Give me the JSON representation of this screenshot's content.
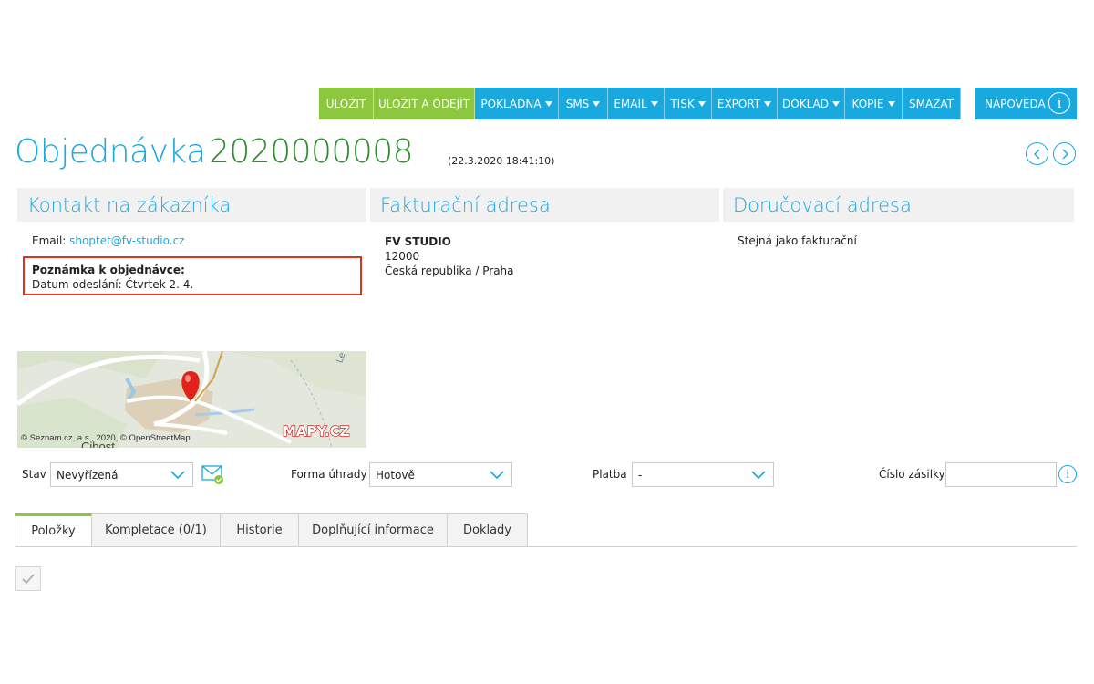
{
  "toolbar": {
    "save": "ULOŽIT",
    "save_exit": "ULOŽIT A ODEJÍT",
    "pokladna": "POKLADNA",
    "sms": "SMS",
    "email": "EMAIL",
    "tisk": "TISK",
    "export": "EXPORT",
    "doklad": "DOKLAD",
    "kopie": "KOPIE",
    "smazat": "SMAZAT",
    "help": "NÁPOVĚDA"
  },
  "header": {
    "title": "Objednávka",
    "order_number": "2020000008",
    "date": "(22.3.2020 18:41:10)"
  },
  "contact": {
    "heading": "Kontakt na zákazníka",
    "email_label": "Email:",
    "email": "shoptet@fv-studio.cz",
    "note_title": "Poznámka k objednávce:",
    "note_text": "Datum odeslání: Čtvrtek 2. 4."
  },
  "billing": {
    "heading": "Fakturační adresa",
    "name": "FV STUDIO",
    "zip": "12000",
    "country_city": "Česká republika / Praha"
  },
  "shipping": {
    "heading": "Doručovací adresa",
    "text": "Stejná jako fakturační"
  },
  "map": {
    "copyright": "© Seznam.cz, a.s., 2020, © OpenStreetMap",
    "logo": "MAPY.CZ",
    "place_fragment": "Cibost",
    "road_label": "Le"
  },
  "filters": {
    "stav_label": "Stav",
    "stav_value": "Nevyřízená",
    "payment_label": "Forma úhrady",
    "payment_value": "Hotově",
    "platba_label": "Platba",
    "platba_value": "-",
    "shipment_label": "Číslo zásilky",
    "shipment_value": ""
  },
  "tabs": [
    "Položky",
    "Kompletace (0/1)",
    "Historie",
    "Doplňující informace",
    "Doklady"
  ],
  "colors": {
    "blue": "#1aa9df",
    "green": "#8dc63f",
    "order_green": "#2e8b2e",
    "note_border": "#e0331d"
  }
}
